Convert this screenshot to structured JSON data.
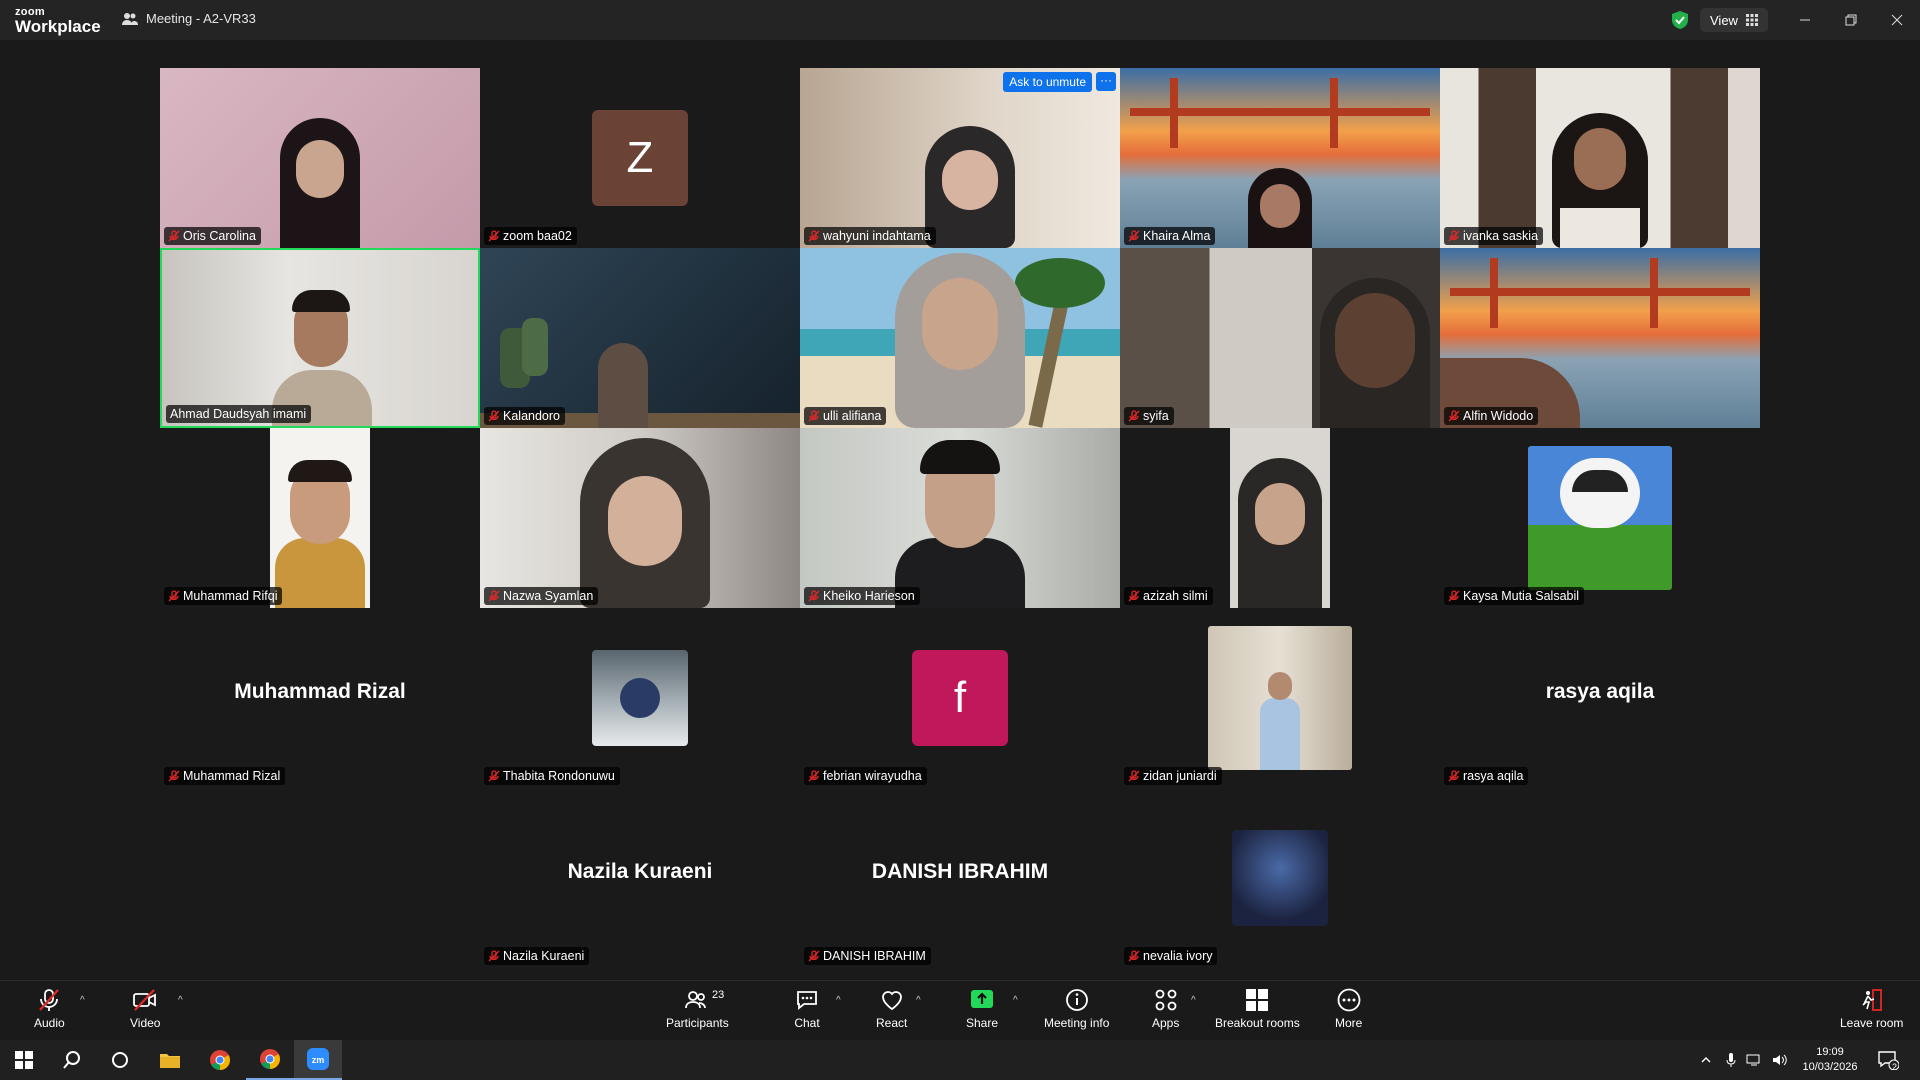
{
  "app": {
    "logo_line1": "zoom",
    "logo_line2": "Workplace",
    "meeting_title": "Meeting - A2-VR33",
    "view_label": "View"
  },
  "tile_action": {
    "ask_to_unmute": "Ask to unmute",
    "more": "···"
  },
  "participants": [
    {
      "name": "Oris Carolina"
    },
    {
      "name": "zoom baa02",
      "avatar_letter": "Z",
      "avatar_color": "#6b4236"
    },
    {
      "name": "wahyuni indahtama"
    },
    {
      "name": "Khaira Alma"
    },
    {
      "name": "ivanka saskia"
    },
    {
      "name": "Ahmad Daudsyah imami"
    },
    {
      "name": "Kalandoro"
    },
    {
      "name": "ulli alifiana"
    },
    {
      "name": "syifa"
    },
    {
      "name": "Alfin Widodo"
    },
    {
      "name": "Muhammad Rifqi"
    },
    {
      "name": "Nazwa Syamlan"
    },
    {
      "name": "Kheiko Harieson"
    },
    {
      "name": "azizah silmi"
    },
    {
      "name": "Kaysa Mutia Salsabil"
    },
    {
      "name": "Muhammad Rizal",
      "big_name": "Muhammad Rizal"
    },
    {
      "name": "Thabita Rondonuwu"
    },
    {
      "name": "febrian wirayudha",
      "avatar_letter": "f",
      "avatar_color": "#c0185a"
    },
    {
      "name": "zidan juniardi"
    },
    {
      "name": "rasya aqila",
      "big_name": "rasya aqila"
    },
    {
      "name": "Nazila Kuraeni",
      "big_name": "Nazila Kuraeni"
    },
    {
      "name": "DANISH IBRAHIM",
      "big_name": "DANISH IBRAHIM"
    },
    {
      "name": "nevalia ivory"
    }
  ],
  "toolbar": {
    "audio": "Audio",
    "video": "Video",
    "participants": "Participants",
    "participants_count": "23",
    "chat": "Chat",
    "react": "React",
    "share": "Share",
    "meeting_info": "Meeting info",
    "apps": "Apps",
    "breakout": "Breakout rooms",
    "more": "More",
    "leave": "Leave room"
  },
  "taskbar": {
    "time": "19:09",
    "date": "10/03/2026",
    "notification_count": "2"
  },
  "colors": {
    "active_speaker": "#23d959",
    "share_green": "#23d959",
    "unmute_blue": "#0e72ed",
    "mute_red": "#e02828"
  }
}
